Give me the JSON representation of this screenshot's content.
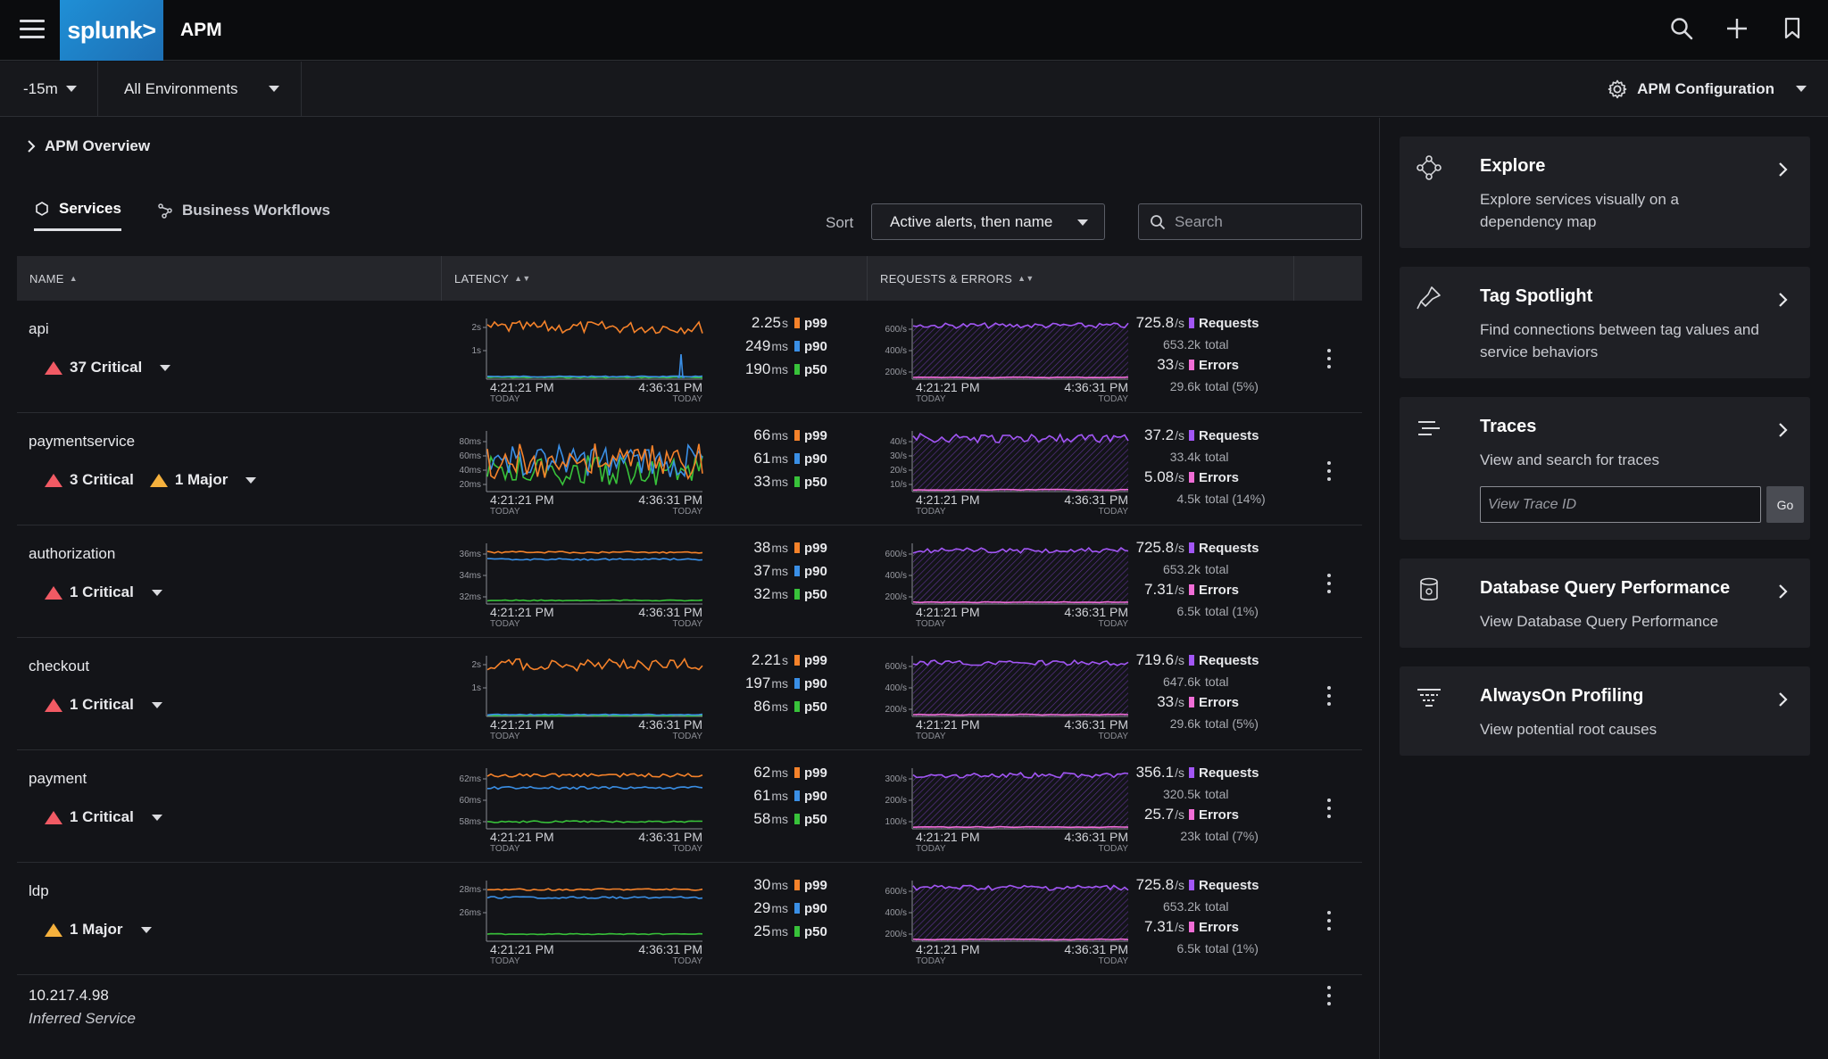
{
  "header": {
    "logo_text": "splunk>",
    "app_title": "APM"
  },
  "filters": {
    "time_range": "-15m",
    "environment": "All Environments",
    "config_label": "APM Configuration"
  },
  "breadcrumb": "APM Overview",
  "tabs": [
    {
      "label": "Services",
      "active": true
    },
    {
      "label": "Business Workflows",
      "active": false
    }
  ],
  "sort": {
    "label": "Sort",
    "value": "Active alerts, then name"
  },
  "search": {
    "placeholder": "Search"
  },
  "columns": {
    "name": "NAME",
    "latency": "LATENCY",
    "requests": "REQUESTS & ERRORS"
  },
  "colors": {
    "p99": "#f5822a",
    "p90": "#3a8fe6",
    "p50": "#38c23a",
    "requests": "#a256f5",
    "errors": "#f06dd6",
    "critical": "#f15a64",
    "major": "#f5b13d"
  },
  "chart_labels": {
    "start": "4:21:21 PM",
    "end": "4:36:31 PM",
    "day": "TODAY"
  },
  "services": [
    {
      "name": "api",
      "alerts": [
        {
          "text": "37 Critical",
          "level": "critical"
        }
      ],
      "latency_ticks": [
        "2s",
        "1s"
      ],
      "latency": [
        {
          "value": "2.25",
          "unit": "s",
          "label": "p99"
        },
        {
          "value": "249",
          "unit": "ms",
          "label": "p90"
        },
        {
          "value": "190",
          "unit": "ms",
          "label": "p50"
        }
      ],
      "req_ticks": [
        "600/s",
        "400/s",
        "200/s"
      ],
      "requests": {
        "rate": "725.8",
        "unit": "/s",
        "label": "Requests",
        "total": "653.2k",
        "total_label": "total"
      },
      "errors": {
        "rate": "33",
        "unit": "/s",
        "label": "Errors",
        "total": "29.6k",
        "total_label": "total (5%)"
      }
    },
    {
      "name": "paymentservice",
      "alerts": [
        {
          "text": "3 Critical",
          "level": "critical"
        },
        {
          "text": "1 Major",
          "level": "major"
        }
      ],
      "latency_ticks": [
        "80ms",
        "60ms",
        "40ms",
        "20ms"
      ],
      "latency": [
        {
          "value": "66",
          "unit": "ms",
          "label": "p99"
        },
        {
          "value": "61",
          "unit": "ms",
          "label": "p90"
        },
        {
          "value": "33",
          "unit": "ms",
          "label": "p50"
        }
      ],
      "req_ticks": [
        "40/s",
        "30/s",
        "20/s",
        "10/s"
      ],
      "requests": {
        "rate": "37.2",
        "unit": "/s",
        "label": "Requests",
        "total": "33.4k",
        "total_label": "total"
      },
      "errors": {
        "rate": "5.08",
        "unit": "/s",
        "label": "Errors",
        "total": "4.5k",
        "total_label": "total (14%)"
      }
    },
    {
      "name": "authorization",
      "alerts": [
        {
          "text": "1 Critical",
          "level": "critical"
        }
      ],
      "latency_ticks": [
        "36ms",
        "34ms",
        "32ms"
      ],
      "latency": [
        {
          "value": "38",
          "unit": "ms",
          "label": "p99"
        },
        {
          "value": "37",
          "unit": "ms",
          "label": "p90"
        },
        {
          "value": "32",
          "unit": "ms",
          "label": "p50"
        }
      ],
      "req_ticks": [
        "600/s",
        "400/s",
        "200/s"
      ],
      "requests": {
        "rate": "725.8",
        "unit": "/s",
        "label": "Requests",
        "total": "653.2k",
        "total_label": "total"
      },
      "errors": {
        "rate": "7.31",
        "unit": "/s",
        "label": "Errors",
        "total": "6.5k",
        "total_label": "total (1%)"
      }
    },
    {
      "name": "checkout",
      "alerts": [
        {
          "text": "1 Critical",
          "level": "critical"
        }
      ],
      "latency_ticks": [
        "2s",
        "1s"
      ],
      "latency": [
        {
          "value": "2.21",
          "unit": "s",
          "label": "p99"
        },
        {
          "value": "197",
          "unit": "ms",
          "label": "p90"
        },
        {
          "value": "86",
          "unit": "ms",
          "label": "p50"
        }
      ],
      "req_ticks": [
        "600/s",
        "400/s",
        "200/s"
      ],
      "requests": {
        "rate": "719.6",
        "unit": "/s",
        "label": "Requests",
        "total": "647.6k",
        "total_label": "total"
      },
      "errors": {
        "rate": "33",
        "unit": "/s",
        "label": "Errors",
        "total": "29.6k",
        "total_label": "total (5%)"
      }
    },
    {
      "name": "payment",
      "alerts": [
        {
          "text": "1 Critical",
          "level": "critical"
        }
      ],
      "latency_ticks": [
        "62ms",
        "60ms",
        "58ms"
      ],
      "latency": [
        {
          "value": "62",
          "unit": "ms",
          "label": "p99"
        },
        {
          "value": "61",
          "unit": "ms",
          "label": "p90"
        },
        {
          "value": "58",
          "unit": "ms",
          "label": "p50"
        }
      ],
      "req_ticks": [
        "300/s",
        "200/s",
        "100/s"
      ],
      "requests": {
        "rate": "356.1",
        "unit": "/s",
        "label": "Requests",
        "total": "320.5k",
        "total_label": "total"
      },
      "errors": {
        "rate": "25.7",
        "unit": "/s",
        "label": "Errors",
        "total": "23k",
        "total_label": "total (7%)"
      }
    },
    {
      "name": "ldp",
      "alerts": [
        {
          "text": "1 Major",
          "level": "major"
        }
      ],
      "latency_ticks": [
        "28ms",
        "26ms"
      ],
      "latency": [
        {
          "value": "30",
          "unit": "ms",
          "label": "p99"
        },
        {
          "value": "29",
          "unit": "ms",
          "label": "p90"
        },
        {
          "value": "25",
          "unit": "ms",
          "label": "p50"
        }
      ],
      "req_ticks": [
        "600/s",
        "400/s",
        "200/s"
      ],
      "requests": {
        "rate": "725.8",
        "unit": "/s",
        "label": "Requests",
        "total": "653.2k",
        "total_label": "total"
      },
      "errors": {
        "rate": "7.31",
        "unit": "/s",
        "label": "Errors",
        "total": "6.5k",
        "total_label": "total (1%)"
      }
    }
  ],
  "inferred": {
    "name": "10.217.4.98",
    "subtitle": "Inferred Service"
  },
  "side": {
    "explore": {
      "title": "Explore",
      "desc": "Explore services visually on a dependency map"
    },
    "tag_spotlight": {
      "title": "Tag Spotlight",
      "desc": "Find connections between tag values and service behaviors"
    },
    "traces": {
      "title": "Traces",
      "desc": "View and search for traces",
      "placeholder": "View Trace ID",
      "go": "Go"
    },
    "db_query": {
      "title": "Database Query Performance",
      "desc": "View Database Query Performance"
    },
    "profiling": {
      "title": "AlwaysOn Profiling",
      "desc": "View potential root causes"
    }
  }
}
